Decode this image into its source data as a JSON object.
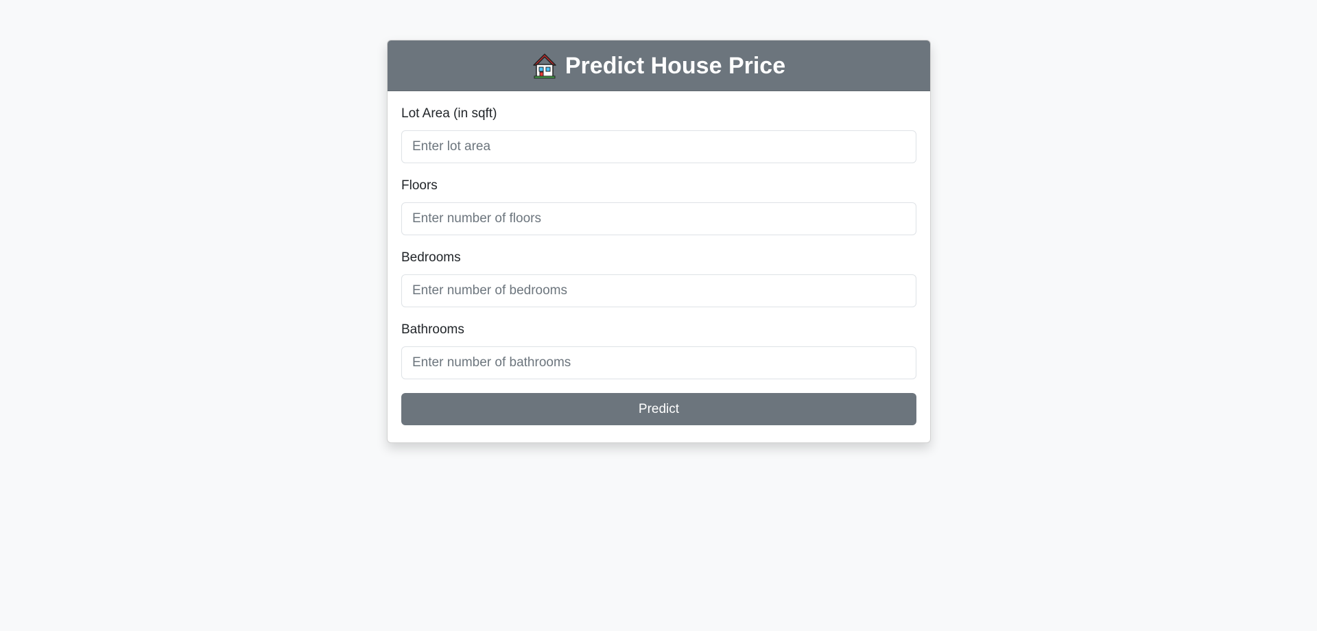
{
  "header": {
    "icon": "house-icon",
    "title": "Predict House Price"
  },
  "form": {
    "fields": [
      {
        "label": "Lot Area (in sqft)",
        "placeholder": "Enter lot area",
        "value": ""
      },
      {
        "label": "Floors",
        "placeholder": "Enter number of floors",
        "value": ""
      },
      {
        "label": "Bedrooms",
        "placeholder": "Enter number of bedrooms",
        "value": ""
      },
      {
        "label": "Bathrooms",
        "placeholder": "Enter number of bathrooms",
        "value": ""
      }
    ],
    "submit_label": "Predict"
  },
  "colors": {
    "page_background": "#f8f9fa",
    "header_background": "#6c757d",
    "button_background": "#6c757d",
    "text": "#212529",
    "placeholder": "#6c757d"
  }
}
